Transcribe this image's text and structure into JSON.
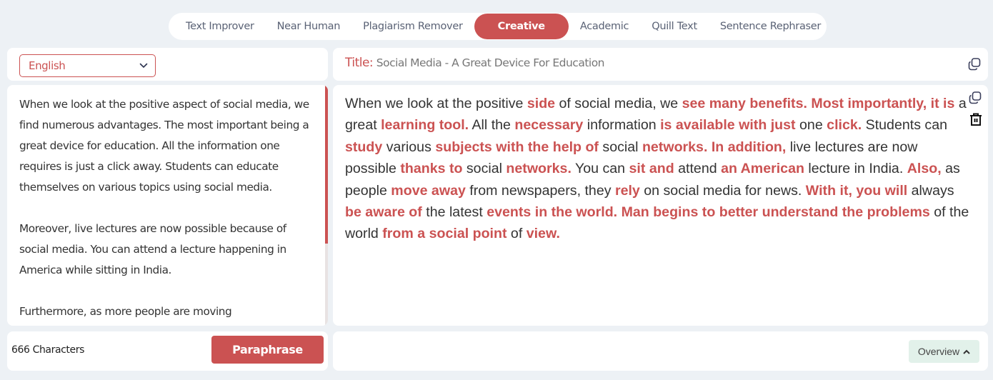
{
  "tabs": [
    {
      "label": "Text Improver",
      "active": false
    },
    {
      "label": "Near Human",
      "active": false
    },
    {
      "label": "Plagiarism Remover",
      "active": false
    },
    {
      "label": "Creative",
      "active": true
    },
    {
      "label": "Academic",
      "active": false
    },
    {
      "label": "Quill Text",
      "active": false
    },
    {
      "label": "Sentence Rephraser",
      "active": false
    }
  ],
  "language": {
    "selected": "English",
    "icon": "chevron-down-icon"
  },
  "title": {
    "label": "Title:",
    "text": "Social Media - A Great Device For Education",
    "copy_icon": "copy-icon"
  },
  "input": {
    "paragraphs": [
      "When we look at the positive aspect of social media, we find numerous advantages. The most important being a great device for education. All the information one requires is just a click away. Students can educate themselves on various topics using social media.",
      "Moreover, live lectures are now possible because of social media. You can attend a lecture happening in America while sitting in India.",
      "Furthermore, as more people are moving"
    ],
    "scroll_position": 0.0
  },
  "output": {
    "segments": [
      {
        "t": "When we look at the positive ",
        "h": false
      },
      {
        "t": "side",
        "h": true
      },
      {
        "t": " of social media, we ",
        "h": false
      },
      {
        "t": "see many benefits. Most importantly, it is",
        "h": true
      },
      {
        "t": " a great ",
        "h": false
      },
      {
        "t": "learning tool.",
        "h": true
      },
      {
        "t": " All the ",
        "h": false
      },
      {
        "t": "necessary",
        "h": true
      },
      {
        "t": " information ",
        "h": false
      },
      {
        "t": "is available with just",
        "h": true
      },
      {
        "t": " one ",
        "h": false
      },
      {
        "t": "click.",
        "h": true
      },
      {
        "t": " Students can ",
        "h": false
      },
      {
        "t": "study",
        "h": true
      },
      {
        "t": " various ",
        "h": false
      },
      {
        "t": "subjects with the help of",
        "h": true
      },
      {
        "t": " social ",
        "h": false
      },
      {
        "t": "networks. In addition,",
        "h": true
      },
      {
        "t": " live lectures are now possible ",
        "h": false
      },
      {
        "t": "thanks to",
        "h": true
      },
      {
        "t": " social ",
        "h": false
      },
      {
        "t": "networks.",
        "h": true
      },
      {
        "t": " You can ",
        "h": false
      },
      {
        "t": "sit and",
        "h": true
      },
      {
        "t": " attend ",
        "h": false
      },
      {
        "t": "an American",
        "h": true
      },
      {
        "t": " lecture in India. ",
        "h": false
      },
      {
        "t": "Also,",
        "h": true
      },
      {
        "t": " as people ",
        "h": false
      },
      {
        "t": "move away",
        "h": true
      },
      {
        "t": " from newspapers, they ",
        "h": false
      },
      {
        "t": "rely",
        "h": true
      },
      {
        "t": " on social media for news. ",
        "h": false
      },
      {
        "t": "With it, you will",
        "h": true
      },
      {
        "t": " always ",
        "h": false
      },
      {
        "t": "be aware of",
        "h": true
      },
      {
        "t": " the latest ",
        "h": false
      },
      {
        "t": "events in the world. Man begins to better understand the problems",
        "h": true
      },
      {
        "t": " of the world ",
        "h": false
      },
      {
        "t": "from a social point",
        "h": true
      },
      {
        "t": " of ",
        "h": false
      },
      {
        "t": "view.",
        "h": true
      }
    ],
    "copy_icon": "copy-icon",
    "delete_icon": "trash-icon"
  },
  "footer": {
    "char_count": "666 Characters",
    "paraphrase_label": "Paraphrase",
    "overview_label": "Overview"
  },
  "colors": {
    "accent": "#cb5252",
    "background": "#edf1f5",
    "overview_bg": "#e2f1ea"
  }
}
